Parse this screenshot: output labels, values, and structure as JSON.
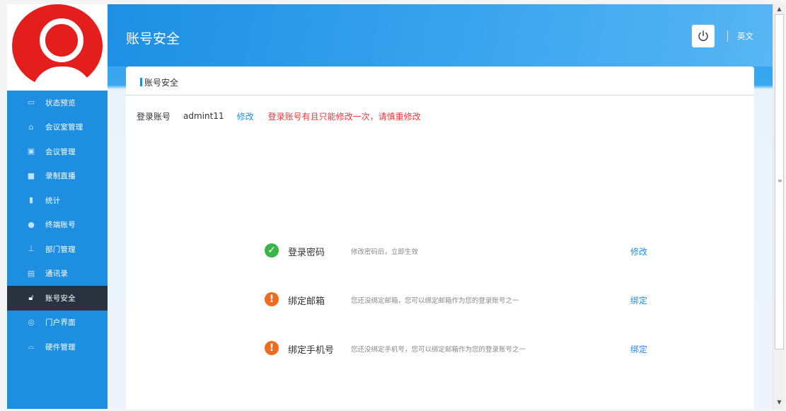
{
  "header": {
    "title": "账号安全",
    "lang_label": "英文"
  },
  "sidebar": {
    "items": [
      {
        "label": "状态预览",
        "icon": "monitor-icon"
      },
      {
        "label": "会议室管理",
        "icon": "home-icon"
      },
      {
        "label": "会议管理",
        "icon": "screen-icon"
      },
      {
        "label": "录制直播",
        "icon": "video-icon"
      },
      {
        "label": "统计",
        "icon": "bar-chart-icon"
      },
      {
        "label": "终端账号",
        "icon": "user-icon"
      },
      {
        "label": "部门管理",
        "icon": "org-chart-icon"
      },
      {
        "label": "通讯录",
        "icon": "contacts-icon"
      },
      {
        "label": "账号安全",
        "icon": "lock-icon",
        "active": true
      },
      {
        "label": "门户界面",
        "icon": "portal-icon"
      },
      {
        "label": "硬件管理",
        "icon": "hardware-icon"
      }
    ]
  },
  "card": {
    "title": "账号安全",
    "account": {
      "label": "登录账号",
      "value": "admint11",
      "edit_label": "修改",
      "note": "登录账号有且只能修改一次，请慎重修改"
    },
    "security": [
      {
        "title": "登录密码",
        "desc": "修改密码后，立即生效",
        "action": "修改",
        "status": "ok"
      },
      {
        "title": "绑定邮箱",
        "desc": "您还没绑定邮箱，您可以绑定邮箱作为您的登录账号之一",
        "action": "绑定",
        "status": "warn"
      },
      {
        "title": "绑定手机号",
        "desc": "您还没绑定手机号，您可以绑定邮箱作为您的登录账号之一",
        "action": "绑定",
        "status": "warn"
      }
    ]
  },
  "colors": {
    "accent": "#1e8ee0",
    "sidebar_active": "#28333f",
    "warning": "#ef6c1f",
    "success": "#3bb54a",
    "note": "#e5383b",
    "logo": "#e41d1d"
  }
}
